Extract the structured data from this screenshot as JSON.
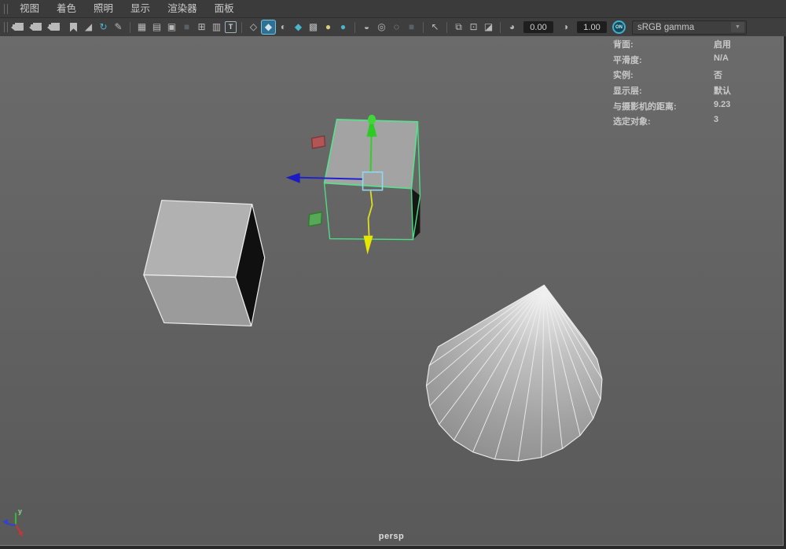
{
  "menu": {
    "items": [
      {
        "name": "menu-view",
        "label": "视图"
      },
      {
        "name": "menu-shading",
        "label": "着色"
      },
      {
        "name": "menu-lighting",
        "label": "照明"
      },
      {
        "name": "menu-show",
        "label": "显示"
      },
      {
        "name": "menu-renderer",
        "label": "渲染器"
      },
      {
        "name": "menu-panels",
        "label": "面板"
      }
    ]
  },
  "toolbar": {
    "exposure_value": "0.00",
    "gamma_value": "1.00",
    "toggle_label": "ON",
    "colorspace_value": "sRGB gamma",
    "dropdown_arrow": "▼",
    "contrast_glyph": "◑",
    "icons": [
      {
        "type": "handle",
        "name": "toolbar-drag-handle"
      },
      {
        "type": "cam",
        "name": "camera-icon"
      },
      {
        "type": "cam",
        "name": "camera-lock-icon"
      },
      {
        "type": "cam",
        "name": "camera-settings-icon"
      },
      {
        "type": "flag",
        "name": "bookmark-icon"
      },
      {
        "glyph": "◢",
        "color": "#b9b9b9",
        "name": "image-plane-icon"
      },
      {
        "glyph": "↻",
        "color": "#4ab5ce",
        "name": "pan-zoom-icon"
      },
      {
        "glyph": "✎",
        "color": "#b9b9b9",
        "name": "grease-pencil-icon"
      },
      {
        "type": "sep"
      },
      {
        "glyph": "▦",
        "color": "#b9b9b9",
        "name": "grid-icon"
      },
      {
        "glyph": "▤",
        "color": "#b9b9b9",
        "name": "film-gate-icon"
      },
      {
        "glyph": "▣",
        "color": "#b9b9b9",
        "name": "resolution-gate-icon"
      },
      {
        "glyph": "■",
        "color": "#596066",
        "name": "gate-mask-icon"
      },
      {
        "glyph": "⊞",
        "color": "#b9b9b9",
        "name": "field-chart-icon"
      },
      {
        "glyph": "▥",
        "color": "#b9b9b9",
        "name": "safe-action-icon"
      },
      {
        "type": "boxT",
        "glyph": "T",
        "name": "safe-title-icon"
      },
      {
        "type": "sep"
      },
      {
        "glyph": "◇",
        "color": "#c6c6c6",
        "name": "wireframe-icon"
      },
      {
        "glyph": "◆",
        "color": "#d3e4ee",
        "name": "smooth-shade-all-icon",
        "selected": true
      },
      {
        "glyph": "◐",
        "color": "#b9b9b9",
        "name": "wireframe-on-shaded-icon"
      },
      {
        "glyph": "◆",
        "color": "#4ab5ce",
        "name": "textured-icon"
      },
      {
        "glyph": "▩",
        "color": "#b9b9b9",
        "name": "use-default-material-icon"
      },
      {
        "glyph": "●",
        "color": "#d6ce7e",
        "name": "lighting-icon"
      },
      {
        "glyph": "●",
        "color": "#4ab5ce",
        "name": "shadows-icon"
      },
      {
        "type": "sep"
      },
      {
        "glyph": "◒",
        "color": "#b9b9b9",
        "name": "ambient-occlusion-icon"
      },
      {
        "glyph": "◎",
        "color": "#b9b9b9",
        "name": "motion-blur-icon"
      },
      {
        "glyph": "◌",
        "color": "#b9b9b9",
        "name": "multisample-icon"
      },
      {
        "glyph": "■",
        "color": "#596066",
        "name": "depth-of-field-icon"
      },
      {
        "type": "sep"
      },
      {
        "glyph": "↖",
        "color": "#b9b9b9",
        "name": "object-selection-icon"
      },
      {
        "type": "sep"
      },
      {
        "glyph": "⧉",
        "color": "#b9b9b9",
        "name": "isolate-select-icon"
      },
      {
        "glyph": "⊡",
        "color": "#b9b9b9",
        "name": "isolate-add-icon"
      },
      {
        "glyph": "◪",
        "color": "#b9b9b9",
        "name": "invert-display-icon"
      },
      {
        "type": "sep"
      },
      {
        "glyph": "◕",
        "color": "#b9b9b9",
        "name": "exposure-icon"
      }
    ]
  },
  "hud": {
    "rows": [
      {
        "label": "背面:",
        "value": "启用"
      },
      {
        "label": "平滑度:",
        "value": "N/A"
      },
      {
        "label": "实例:",
        "value": "否"
      },
      {
        "label": "显示层:",
        "value": "默认"
      },
      {
        "label": "与摄影机的距离:",
        "value": "9.23"
      },
      {
        "label": "选定对象:",
        "value": "3"
      }
    ]
  },
  "viewport": {
    "camera_label": "persp",
    "axis_label_y": "y"
  },
  "colors": {
    "selection_green": "#57e28c",
    "manip_axis_y_green": "#35cc2e",
    "manip_axis_z_blue": "#2222cc",
    "manip_axis_selected_yellow": "#e0e020",
    "manip_center_cyan": "#8fd8ef",
    "accent_teal": "#4ab5ce",
    "viewport_gray": "#636363",
    "bar_gray": "#3e3e3e"
  }
}
